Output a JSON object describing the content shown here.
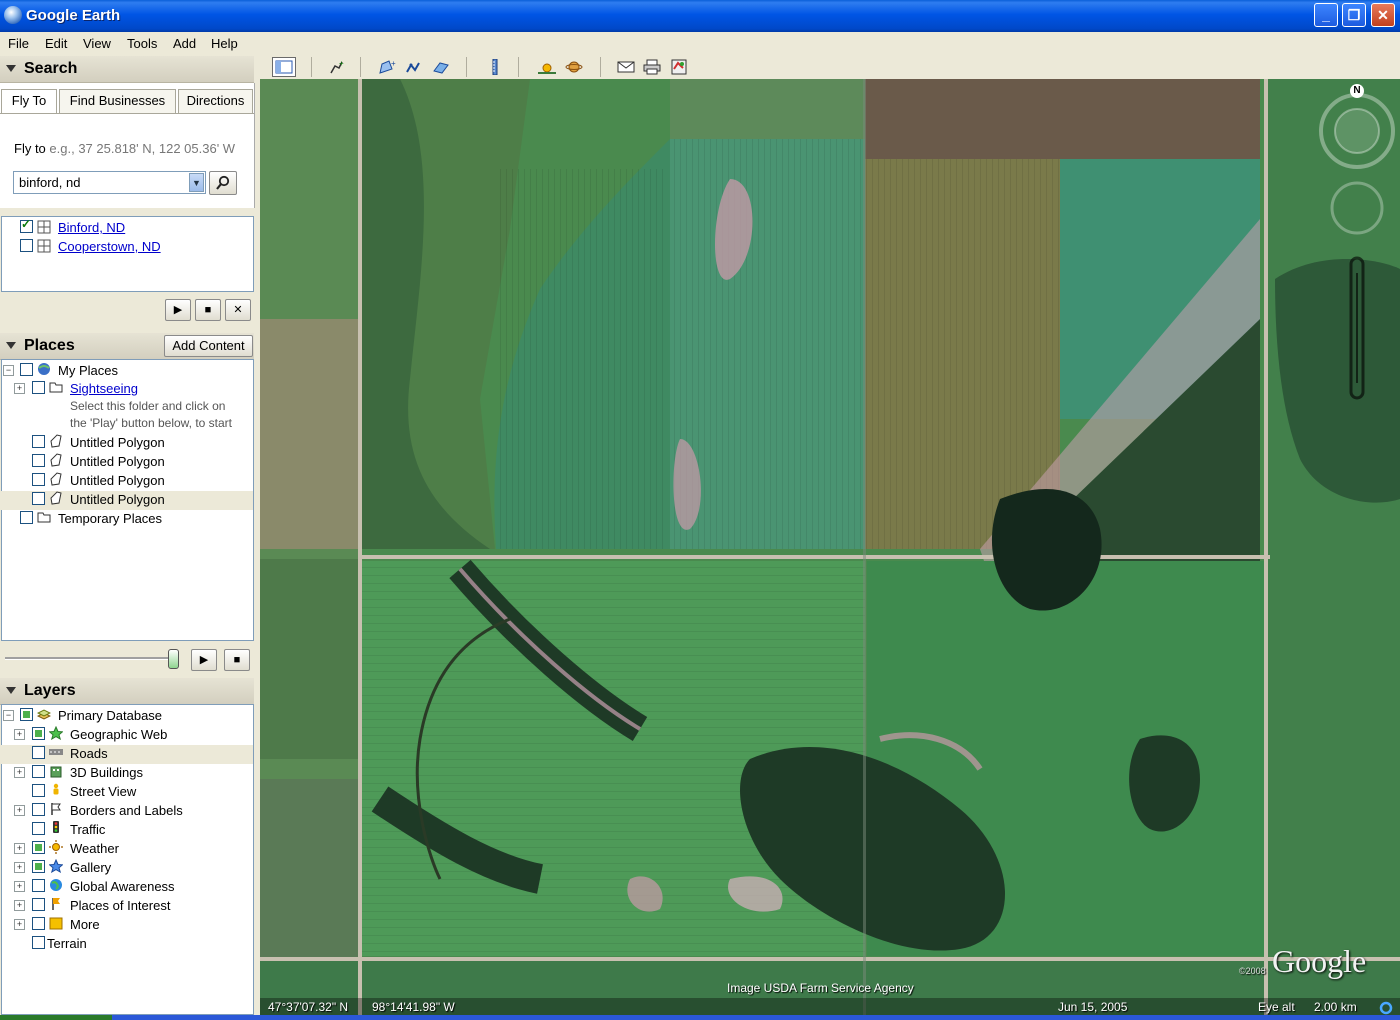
{
  "window": {
    "title": "Google Earth",
    "controls": [
      "_",
      "❐",
      "✕"
    ]
  },
  "menu": [
    "File",
    "Edit",
    "View",
    "Tools",
    "Add",
    "Help"
  ],
  "search": {
    "header": "Search",
    "tabs": [
      "Fly To",
      "Find Businesses",
      "Directions"
    ],
    "fly_to_label": "Fly to",
    "fly_to_hint": "e.g., 37 25.818' N, 122 05.36' W",
    "input_value": "binford, nd",
    "results": [
      "Binford, ND",
      "Cooperstown, ND"
    ]
  },
  "places": {
    "header": "Places",
    "add_content": "Add Content",
    "my_places": "My Places",
    "sightseeing": "Sightseeing",
    "hint_line1": "Select this folder and click on",
    "hint_line2": "the 'Play' button below, to start",
    "polygons": [
      "Untitled Polygon",
      "Untitled Polygon",
      "Untitled Polygon",
      "Untitled Polygon"
    ],
    "temporary": "Temporary Places"
  },
  "layers": {
    "header": "Layers",
    "primary": "Primary Database",
    "items": [
      "Geographic Web",
      "Roads",
      "3D Buildings",
      "Street View",
      "Borders and Labels",
      "Traffic",
      "Weather",
      "Gallery",
      "Global Awareness",
      "Places of Interest",
      "More",
      "Terrain"
    ]
  },
  "status": {
    "lat": "47°37'07.32\" N",
    "lon": "98°14'41.98\" W",
    "imagery": "Image USDA Farm Service Agency",
    "date": "Jun 15, 2005",
    "eye_alt_label": "Eye alt",
    "eye_alt_value": "2.00 km",
    "copyright": "©2008",
    "logo": "Google",
    "compass_n": "N"
  }
}
